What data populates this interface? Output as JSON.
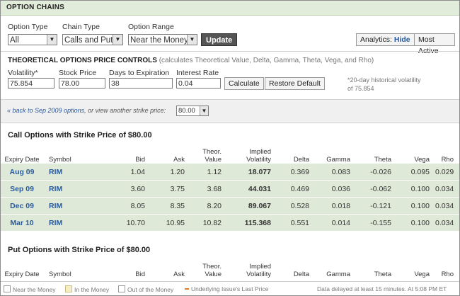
{
  "header": {
    "title": "OPTION CHAINS"
  },
  "filters": {
    "option_type": {
      "label": "Option Type",
      "value": "All"
    },
    "chain_type": {
      "label": "Chain Type",
      "value": "Calls and Puts"
    },
    "option_range": {
      "label": "Option Range",
      "value": "Near the Money"
    },
    "update_label": "Update",
    "analytics_label": "Analytics:",
    "analytics_toggle": "Hide",
    "most_active_label": "Most Active"
  },
  "theoretical": {
    "title": "THEORETICAL OPTIONS PRICE CONTROLS",
    "subtitle": "(calculates Theoretical Value, Delta, Gamma, Theta, Vega, and Rho)",
    "volatility": {
      "label": "Volatility*",
      "value": "75.854"
    },
    "stock_price": {
      "label": "Stock Price",
      "value": "78.00"
    },
    "days": {
      "label": "Days to Expiration",
      "value": "38"
    },
    "interest": {
      "label": "Interest Rate",
      "value": "0.04"
    },
    "calculate_label": "Calculate",
    "restore_label": "Restore Default",
    "note": "*20-day historical volatility of 75.854"
  },
  "nav": {
    "back_link": "« back to Sep 2009 options",
    "text": ", or view another strike price:",
    "strike_value": "80.00"
  },
  "columns": [
    "Expiry Date",
    "Symbol",
    "Bid",
    "Ask",
    "Theor. Value",
    "Implied Volatility",
    "Delta",
    "Gamma",
    "Theta",
    "Vega",
    "Rho"
  ],
  "calls": {
    "title": "Call Options with Strike Price of $80.00",
    "rows": [
      [
        "Aug 09",
        "RIM",
        "1.04",
        "1.20",
        "1.12",
        "18.077",
        "0.369",
        "0.083",
        "-0.026",
        "0.095",
        "0.029"
      ],
      [
        "Sep 09",
        "RIM",
        "3.60",
        "3.75",
        "3.68",
        "44.031",
        "0.469",
        "0.036",
        "-0.062",
        "0.100",
        "0.034"
      ],
      [
        "Dec 09",
        "RIM",
        "8.05",
        "8.35",
        "8.20",
        "89.067",
        "0.528",
        "0.018",
        "-0.121",
        "0.100",
        "0.034"
      ],
      [
        "Mar 10",
        "RIM",
        "10.70",
        "10.95",
        "10.82",
        "115.368",
        "0.551",
        "0.014",
        "-0.155",
        "0.100",
        "0.034"
      ]
    ]
  },
  "puts": {
    "title": "Put Options with Strike Price of $80.00"
  },
  "footer": {
    "near": "Near the Money",
    "in": "In the Money",
    "out": "Out of the Money",
    "last": "Underlying Issue's Last Price",
    "delay": "Data delayed at least 15 minutes.  At 5:08 PM ET"
  }
}
